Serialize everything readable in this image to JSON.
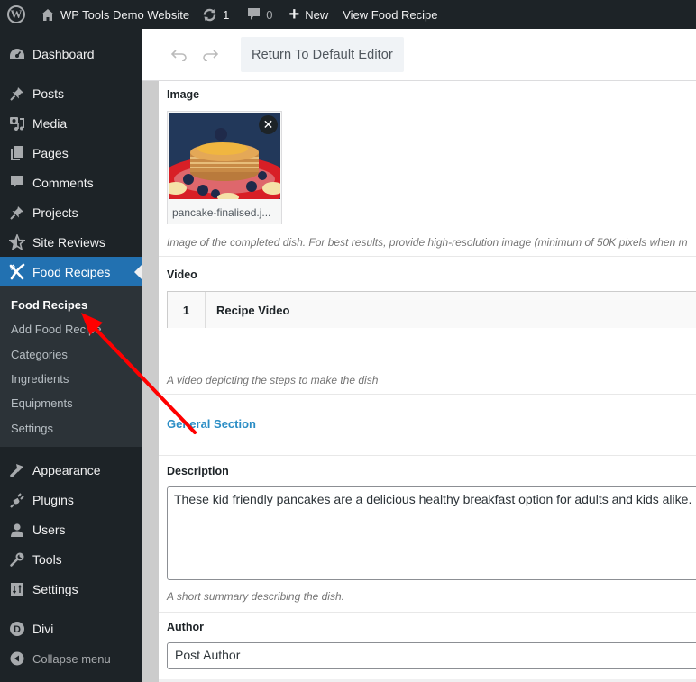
{
  "adminbar": {
    "site_name": "WP Tools Demo Website",
    "updates_count": "1",
    "comments_count": "0",
    "new_label": "New",
    "view_label": "View Food Recipe"
  },
  "sidebar": {
    "items": [
      {
        "label": "Dashboard",
        "icon": "dashboard-icon"
      },
      {
        "label": "Posts",
        "icon": "pin-icon"
      },
      {
        "label": "Media",
        "icon": "media-icon"
      },
      {
        "label": "Pages",
        "icon": "pages-icon"
      },
      {
        "label": "Comments",
        "icon": "comment-icon"
      },
      {
        "label": "Projects",
        "icon": "pin-icon"
      },
      {
        "label": "Site Reviews",
        "icon": "star-icon"
      },
      {
        "label": "Food Recipes",
        "icon": "fork-knife-icon",
        "active": true
      },
      {
        "label": "Appearance",
        "icon": "brush-icon"
      },
      {
        "label": "Plugins",
        "icon": "plug-icon"
      },
      {
        "label": "Users",
        "icon": "user-icon"
      },
      {
        "label": "Tools",
        "icon": "wrench-icon"
      },
      {
        "label": "Settings",
        "icon": "settings-icon"
      },
      {
        "label": "Divi",
        "icon": "divi-icon"
      },
      {
        "label": "Collapse menu",
        "icon": "collapse-icon"
      }
    ],
    "submenu": [
      {
        "label": "Food Recipes",
        "current": true
      },
      {
        "label": "Add Food Recipe"
      },
      {
        "label": "Categories"
      },
      {
        "label": "Ingredients"
      },
      {
        "label": "Equipments"
      },
      {
        "label": "Settings"
      }
    ]
  },
  "toolbar": {
    "undo_icon": "undo-icon",
    "redo_icon": "redo-icon",
    "return_label": "Return To Default Editor"
  },
  "fields": {
    "image": {
      "label": "Image",
      "filename": "pancake-finalised.j...",
      "description": "Image of the completed dish. For best results, provide high-resolution image (minimum of 50K pixels when m"
    },
    "video": {
      "label": "Video",
      "row_number": "1",
      "row_title": "Recipe Video",
      "description": "A video depicting the steps to make the dish"
    },
    "section": {
      "label": "General Section"
    },
    "description": {
      "label": "Description",
      "value": "These kid friendly pancakes are a delicious healthy breakfast option for adults and kids alike.",
      "description": "A short summary describing the dish."
    },
    "author": {
      "label": "Author",
      "value": "Post Author"
    }
  },
  "colors": {
    "adminbar_bg": "#1d2327",
    "active_menu": "#2271b1",
    "link_blue": "#2a8dc5",
    "annotation_arrow": "#ff0000"
  }
}
